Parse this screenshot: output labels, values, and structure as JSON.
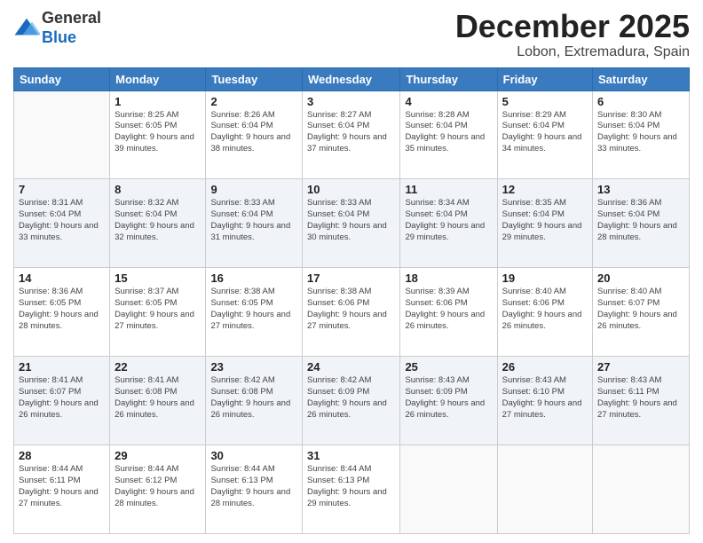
{
  "header": {
    "logo_line1": "General",
    "logo_line2": "Blue",
    "month": "December 2025",
    "location": "Lobon, Extremadura, Spain"
  },
  "weekdays": [
    "Sunday",
    "Monday",
    "Tuesday",
    "Wednesday",
    "Thursday",
    "Friday",
    "Saturday"
  ],
  "weeks": [
    [
      {
        "day": "",
        "sunrise": "",
        "sunset": "",
        "daylight": ""
      },
      {
        "day": "1",
        "sunrise": "Sunrise: 8:25 AM",
        "sunset": "Sunset: 6:05 PM",
        "daylight": "Daylight: 9 hours and 39 minutes."
      },
      {
        "day": "2",
        "sunrise": "Sunrise: 8:26 AM",
        "sunset": "Sunset: 6:04 PM",
        "daylight": "Daylight: 9 hours and 38 minutes."
      },
      {
        "day": "3",
        "sunrise": "Sunrise: 8:27 AM",
        "sunset": "Sunset: 6:04 PM",
        "daylight": "Daylight: 9 hours and 37 minutes."
      },
      {
        "day": "4",
        "sunrise": "Sunrise: 8:28 AM",
        "sunset": "Sunset: 6:04 PM",
        "daylight": "Daylight: 9 hours and 35 minutes."
      },
      {
        "day": "5",
        "sunrise": "Sunrise: 8:29 AM",
        "sunset": "Sunset: 6:04 PM",
        "daylight": "Daylight: 9 hours and 34 minutes."
      },
      {
        "day": "6",
        "sunrise": "Sunrise: 8:30 AM",
        "sunset": "Sunset: 6:04 PM",
        "daylight": "Daylight: 9 hours and 33 minutes."
      }
    ],
    [
      {
        "day": "7",
        "sunrise": "Sunrise: 8:31 AM",
        "sunset": "Sunset: 6:04 PM",
        "daylight": "Daylight: 9 hours and 33 minutes."
      },
      {
        "day": "8",
        "sunrise": "Sunrise: 8:32 AM",
        "sunset": "Sunset: 6:04 PM",
        "daylight": "Daylight: 9 hours and 32 minutes."
      },
      {
        "day": "9",
        "sunrise": "Sunrise: 8:33 AM",
        "sunset": "Sunset: 6:04 PM",
        "daylight": "Daylight: 9 hours and 31 minutes."
      },
      {
        "day": "10",
        "sunrise": "Sunrise: 8:33 AM",
        "sunset": "Sunset: 6:04 PM",
        "daylight": "Daylight: 9 hours and 30 minutes."
      },
      {
        "day": "11",
        "sunrise": "Sunrise: 8:34 AM",
        "sunset": "Sunset: 6:04 PM",
        "daylight": "Daylight: 9 hours and 29 minutes."
      },
      {
        "day": "12",
        "sunrise": "Sunrise: 8:35 AM",
        "sunset": "Sunset: 6:04 PM",
        "daylight": "Daylight: 9 hours and 29 minutes."
      },
      {
        "day": "13",
        "sunrise": "Sunrise: 8:36 AM",
        "sunset": "Sunset: 6:04 PM",
        "daylight": "Daylight: 9 hours and 28 minutes."
      }
    ],
    [
      {
        "day": "14",
        "sunrise": "Sunrise: 8:36 AM",
        "sunset": "Sunset: 6:05 PM",
        "daylight": "Daylight: 9 hours and 28 minutes."
      },
      {
        "day": "15",
        "sunrise": "Sunrise: 8:37 AM",
        "sunset": "Sunset: 6:05 PM",
        "daylight": "Daylight: 9 hours and 27 minutes."
      },
      {
        "day": "16",
        "sunrise": "Sunrise: 8:38 AM",
        "sunset": "Sunset: 6:05 PM",
        "daylight": "Daylight: 9 hours and 27 minutes."
      },
      {
        "day": "17",
        "sunrise": "Sunrise: 8:38 AM",
        "sunset": "Sunset: 6:06 PM",
        "daylight": "Daylight: 9 hours and 27 minutes."
      },
      {
        "day": "18",
        "sunrise": "Sunrise: 8:39 AM",
        "sunset": "Sunset: 6:06 PM",
        "daylight": "Daylight: 9 hours and 26 minutes."
      },
      {
        "day": "19",
        "sunrise": "Sunrise: 8:40 AM",
        "sunset": "Sunset: 6:06 PM",
        "daylight": "Daylight: 9 hours and 26 minutes."
      },
      {
        "day": "20",
        "sunrise": "Sunrise: 8:40 AM",
        "sunset": "Sunset: 6:07 PM",
        "daylight": "Daylight: 9 hours and 26 minutes."
      }
    ],
    [
      {
        "day": "21",
        "sunrise": "Sunrise: 8:41 AM",
        "sunset": "Sunset: 6:07 PM",
        "daylight": "Daylight: 9 hours and 26 minutes."
      },
      {
        "day": "22",
        "sunrise": "Sunrise: 8:41 AM",
        "sunset": "Sunset: 6:08 PM",
        "daylight": "Daylight: 9 hours and 26 minutes."
      },
      {
        "day": "23",
        "sunrise": "Sunrise: 8:42 AM",
        "sunset": "Sunset: 6:08 PM",
        "daylight": "Daylight: 9 hours and 26 minutes."
      },
      {
        "day": "24",
        "sunrise": "Sunrise: 8:42 AM",
        "sunset": "Sunset: 6:09 PM",
        "daylight": "Daylight: 9 hours and 26 minutes."
      },
      {
        "day": "25",
        "sunrise": "Sunrise: 8:43 AM",
        "sunset": "Sunset: 6:09 PM",
        "daylight": "Daylight: 9 hours and 26 minutes."
      },
      {
        "day": "26",
        "sunrise": "Sunrise: 8:43 AM",
        "sunset": "Sunset: 6:10 PM",
        "daylight": "Daylight: 9 hours and 27 minutes."
      },
      {
        "day": "27",
        "sunrise": "Sunrise: 8:43 AM",
        "sunset": "Sunset: 6:11 PM",
        "daylight": "Daylight: 9 hours and 27 minutes."
      }
    ],
    [
      {
        "day": "28",
        "sunrise": "Sunrise: 8:44 AM",
        "sunset": "Sunset: 6:11 PM",
        "daylight": "Daylight: 9 hours and 27 minutes."
      },
      {
        "day": "29",
        "sunrise": "Sunrise: 8:44 AM",
        "sunset": "Sunset: 6:12 PM",
        "daylight": "Daylight: 9 hours and 28 minutes."
      },
      {
        "day": "30",
        "sunrise": "Sunrise: 8:44 AM",
        "sunset": "Sunset: 6:13 PM",
        "daylight": "Daylight: 9 hours and 28 minutes."
      },
      {
        "day": "31",
        "sunrise": "Sunrise: 8:44 AM",
        "sunset": "Sunset: 6:13 PM",
        "daylight": "Daylight: 9 hours and 29 minutes."
      },
      {
        "day": "",
        "sunrise": "",
        "sunset": "",
        "daylight": ""
      },
      {
        "day": "",
        "sunrise": "",
        "sunset": "",
        "daylight": ""
      },
      {
        "day": "",
        "sunrise": "",
        "sunset": "",
        "daylight": ""
      }
    ]
  ]
}
